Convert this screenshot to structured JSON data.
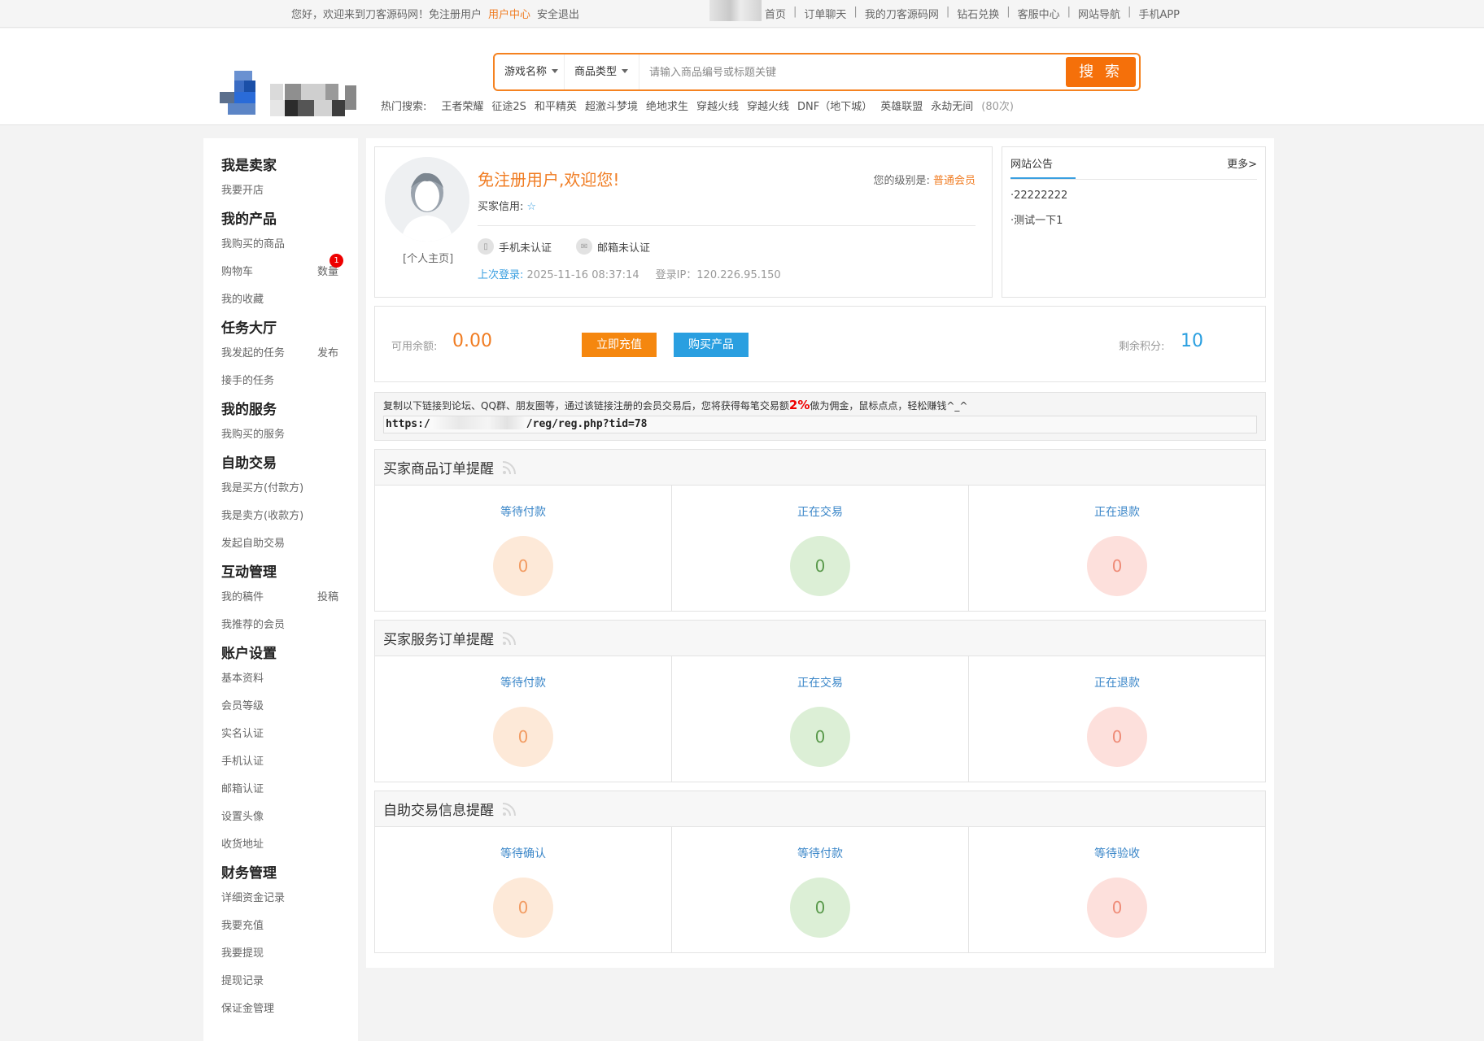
{
  "topbar": {
    "greeting": "您好，欢迎来到刀客源码网！免注册用户",
    "user_center": "用户中心",
    "logout": "安全退出",
    "nav": [
      "首页",
      "订单聊天",
      "我的刀客源码网",
      "钻石兑换",
      "客服中心",
      "网站导航",
      "手机APP"
    ]
  },
  "search": {
    "game_dropdown": "游戏名称",
    "type_dropdown": "商品类型",
    "placeholder": "请输入商品编号或标题关键",
    "button": "搜 索"
  },
  "hot": {
    "label": "热门搜索:",
    "items": [
      "王者荣耀",
      "征途2S",
      "和平精英",
      "超激斗梦境",
      "绝地求生",
      "穿越火线",
      "穿越火线",
      "DNF（地下城）",
      "英雄联盟",
      "永劫无间"
    ],
    "count": "(80次)"
  },
  "sidebar": {
    "groups": [
      {
        "title": "我是卖家",
        "items": [
          {
            "label": "我要开店"
          }
        ]
      },
      {
        "title": "我的产品",
        "items": [
          {
            "label": "我购买的商品"
          },
          {
            "label": "购物车",
            "extra": "数量",
            "badge": "1"
          },
          {
            "label": "我的收藏"
          }
        ]
      },
      {
        "title": "任务大厅",
        "items": [
          {
            "label": "我发起的任务",
            "extra": "发布"
          },
          {
            "label": "接手的任务"
          }
        ]
      },
      {
        "title": "我的服务",
        "items": [
          {
            "label": "我购买的服务"
          }
        ]
      },
      {
        "title": "自助交易",
        "items": [
          {
            "label": "我是买方(付款方)"
          },
          {
            "label": "我是卖方(收款方)"
          },
          {
            "label": "发起自助交易"
          }
        ]
      },
      {
        "title": "互动管理",
        "items": [
          {
            "label": "我的稿件",
            "extra": "投稿"
          },
          {
            "label": "我推荐的会员"
          }
        ]
      },
      {
        "title": "账户设置",
        "items": [
          {
            "label": "基本资料"
          },
          {
            "label": "会员等级"
          },
          {
            "label": "实名认证"
          },
          {
            "label": "手机认证"
          },
          {
            "label": "邮箱认证"
          },
          {
            "label": "设置头像"
          },
          {
            "label": "收货地址"
          }
        ]
      },
      {
        "title": "财务管理",
        "items": [
          {
            "label": "详细资金记录"
          },
          {
            "label": "我要充值"
          },
          {
            "label": "我要提现"
          },
          {
            "label": "提现记录"
          },
          {
            "label": "保证金管理"
          }
        ]
      }
    ]
  },
  "profile": {
    "home_link": "[个人主页]",
    "welcome": "免注册用户,欢迎您!",
    "level_label": "您的级别是:",
    "level_value": "普通会员",
    "credit_label": "买家信用:",
    "phone_status": "手机未认证",
    "email_status": "邮箱未认证",
    "last_login_label": "上次登录:",
    "last_login_time": "2025-11-16 08:37:14",
    "login_ip": "登录IP：120.226.95.150"
  },
  "notice": {
    "title": "网站公告",
    "more": "更多>",
    "items": [
      "·22222222",
      "·测试一下1"
    ]
  },
  "balance": {
    "label": "可用余额:",
    "value": "0.00",
    "recharge": "立即充值",
    "buy": "购买产品",
    "points_label": "剩余积分:",
    "points_value": "10"
  },
  "referral": {
    "text_before": "复制以下链接到论坛、QQ群、朋友圈等，通过该链接注册的会员交易后，您将获得每笔交易额",
    "percent": "2%",
    "text_after": "做为佣金，鼠标点点，轻松赚钱^_^",
    "link_prefix": "https:/",
    "link_suffix": "/reg/reg.php?tid=78"
  },
  "sections": [
    {
      "title": "买家商品订单提醒",
      "cols": [
        {
          "label": "等待付款",
          "value": "0"
        },
        {
          "label": "正在交易",
          "value": "0"
        },
        {
          "label": "正在退款",
          "value": "0"
        }
      ]
    },
    {
      "title": "买家服务订单提醒",
      "cols": [
        {
          "label": "等待付款",
          "value": "0"
        },
        {
          "label": "正在交易",
          "value": "0"
        },
        {
          "label": "正在退款",
          "value": "0"
        }
      ]
    },
    {
      "title": "自助交易信息提醒",
      "cols": [
        {
          "label": "等待确认",
          "value": "0"
        },
        {
          "label": "等待付款",
          "value": "0"
        },
        {
          "label": "等待验收",
          "value": "0"
        }
      ]
    }
  ]
}
